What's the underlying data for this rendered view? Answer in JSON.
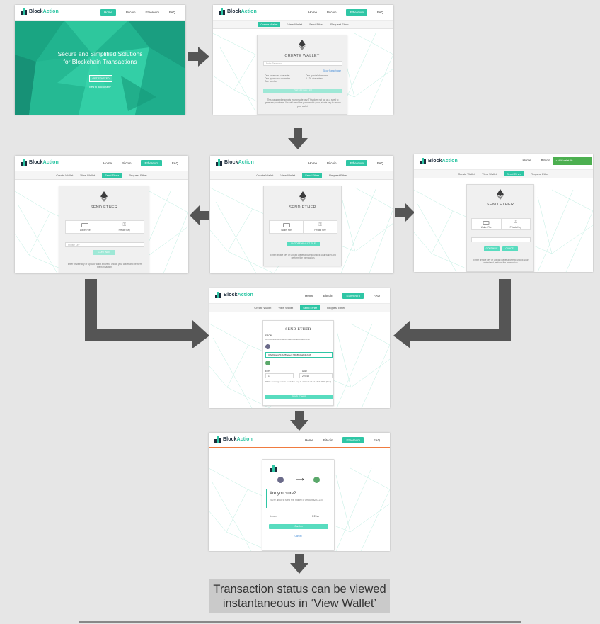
{
  "brand": {
    "name_a": "Block",
    "name_b": "Action",
    "tagline": "Secure and Simplified Solutions"
  },
  "nav": {
    "home": "Home",
    "bitcoin": "Bitcoin",
    "ethereum": "Ethereum",
    "faq": "FAQ"
  },
  "subnav": {
    "create": "Create Wallet",
    "view": "View Wallet",
    "send": "Send Ether",
    "request": "Request Ether"
  },
  "hero": {
    "line1": "Secure and Simplified Solutions",
    "line2": "for Blockchain Transactions",
    "button": "GET STARTED",
    "sub": "New to Blockchain?"
  },
  "create": {
    "title": "CREATE WALLET",
    "placeholder": "Enter Password",
    "show": "Show Passphrase",
    "rules": [
      "One lowercase character",
      "One uppercase character",
      "One number",
      "One special character",
      "8 - 20 characters"
    ],
    "button": "CREATE WALLET",
    "note": "This password encrypts your private key. This does not act as a seed to generate your keys. You will need this password + your private key to unlock your wallet."
  },
  "send": {
    "title": "SEND ETHER",
    "wallet_file": "Wallet File",
    "private_key": "Private Key",
    "pk_placeholder": "Private Key",
    "continue": "CONTINUE",
    "choose": "CHOOSE WALLET FILE",
    "note": "Enter private key or upload wallet above to unlock your wallet and perform the transaction.",
    "continue2": "CONTINUE",
    "cancel": "CANCEL"
  },
  "toast": "Valid wallet file",
  "send_form": {
    "title": "SEND ETHER",
    "from_label": "FROM",
    "from_addr": "0x7b2b839fcb6c5f0ac45f4aa5b8d9a6520a8b4c5ef",
    "to_addr": "0x6d815e1c7b1b4f59e8ec1780b8f1f2a6b3ef1c8",
    "eth_label": "ETH",
    "usd_label": "USD",
    "eth_value": "1",
    "usd_value": "297.43",
    "note": "** The exchange rate is as of Mon Sep 11 2017 11:26:13 GMT+0800 (SGT)",
    "button": "SEND ETHER"
  },
  "confirm": {
    "title": "Are you sure?",
    "body": "You're about to send real money of amount $297.230",
    "amount_label": "Amount",
    "amount_value": "1 Ether",
    "confirm": "Confirm",
    "cancel": "Cancel"
  },
  "caption": {
    "line1": "Transaction status can be viewed",
    "line2": "instantaneous in ‘View Wallet’"
  },
  "colors": {
    "accent": "#2fc6a5",
    "arrow": "#555555",
    "caption_bg": "#cacaca"
  }
}
